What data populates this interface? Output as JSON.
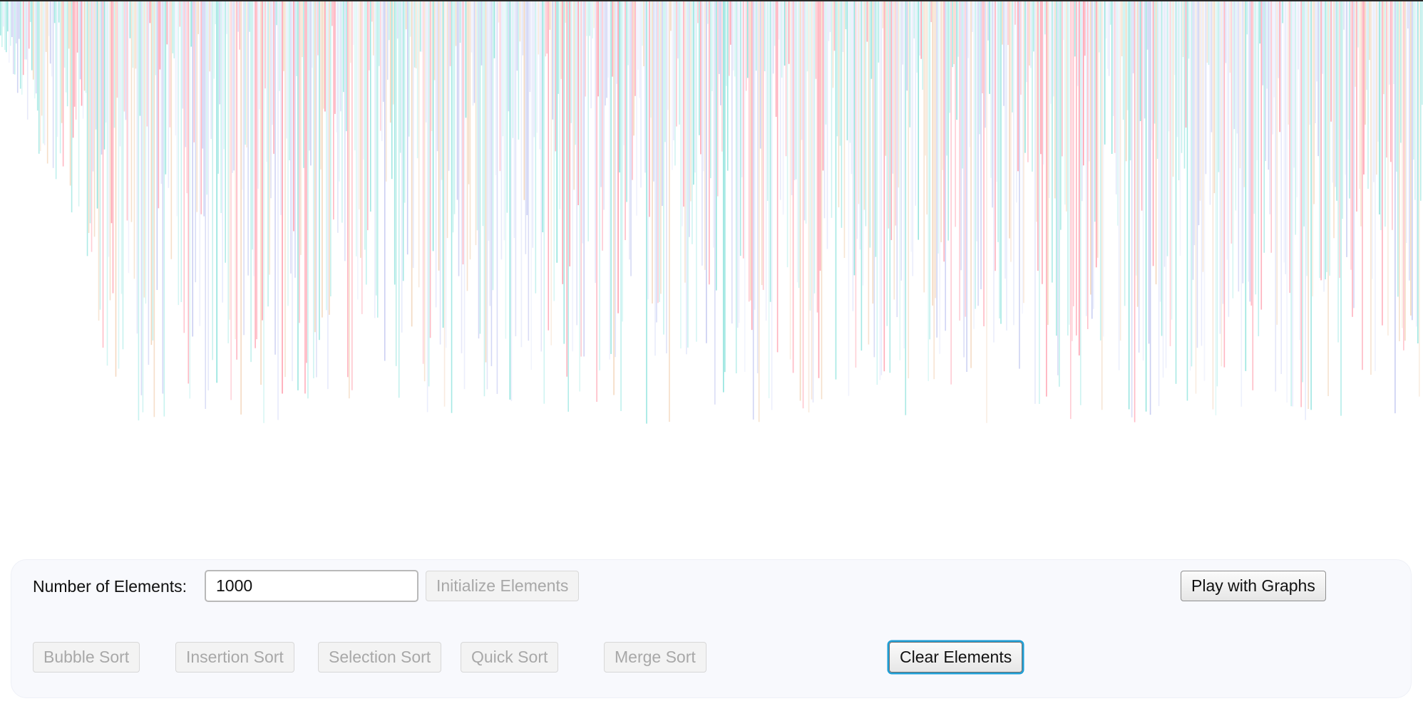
{
  "visualization": {
    "element_count": 1000,
    "bar_colors": [
      "#ff9fae",
      "#8fe3dd",
      "#c8cdf2",
      "#f3d7bd",
      "#bff0ed",
      "#e4e8fb"
    ],
    "background": "#ffffff"
  },
  "controls": {
    "count_label": "Number of Elements:",
    "count_value": "1000",
    "initialize_label": "Initialize Elements",
    "graphs_label": "Play with Graphs",
    "clear_label": "Clear Elements",
    "sorts": {
      "bubble": "Bubble Sort",
      "insertion": "Insertion Sort",
      "selection": "Selection Sort",
      "quick": "Quick Sort",
      "merge": "Merge Sort"
    }
  },
  "colors": {
    "panel_background": "#f8f9fd",
    "focus_ring": "#1f9fd6",
    "disabled_text": "#a8a8a8"
  }
}
